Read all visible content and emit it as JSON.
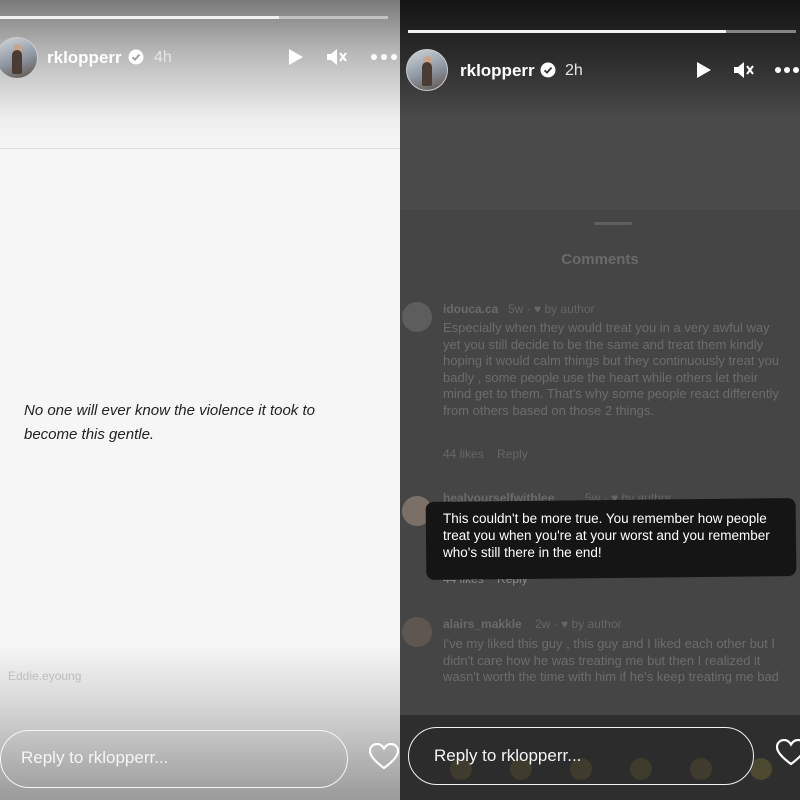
{
  "left_story": {
    "username": "rklopperr",
    "time": "4h",
    "quote": "No one will ever know the violence it took to become this gentle.",
    "faded_caption": "Eddie.eyoung",
    "reply_placeholder": "Reply to rklopperr...",
    "progress_fraction": 0.72
  },
  "right_story": {
    "username": "rklopperr",
    "time": "2h",
    "comments_title": "Comments",
    "reply_placeholder": "Reply to rklopperr...",
    "progress_fraction": 0.82,
    "comments": [
      {
        "user": "idouca.ca",
        "meta": "5w · ♥ by author",
        "text": "Especially when they would treat you in a very awful way yet you still decide to be the same and treat them kindly hoping it would calm things but they continuously treat you badly , some people use the heart while others let their mind get to them. That's why some people react differently from others based on those 2 things.",
        "footer": "44 likes    Reply"
      },
      {
        "user": "healyourselfwithlee",
        "meta": "5w · ♥ by author",
        "text": "This couldn't be more true. You remember how people treat you when you're at your worst and you remember who's still there in the end!",
        "footer": "44 likes    Reply"
      },
      {
        "user": "alairs_makkle",
        "meta": "2w · ♥ by author",
        "text": "I've my liked this guy , this guy and I liked each other but I didn't care how he was treating me but then I realized it wasn't worth the time with him if he's keep treating me bad",
        "footer": ""
      }
    ]
  },
  "colors": {
    "left_bg": "#f6f6f6",
    "right_bg": "#4b4b4b",
    "highlight_bg": "#151515",
    "verified": "#3897f0"
  },
  "icons": [
    "play-icon",
    "mute-icon",
    "more-icon",
    "verified-badge-icon",
    "heart-icon"
  ]
}
